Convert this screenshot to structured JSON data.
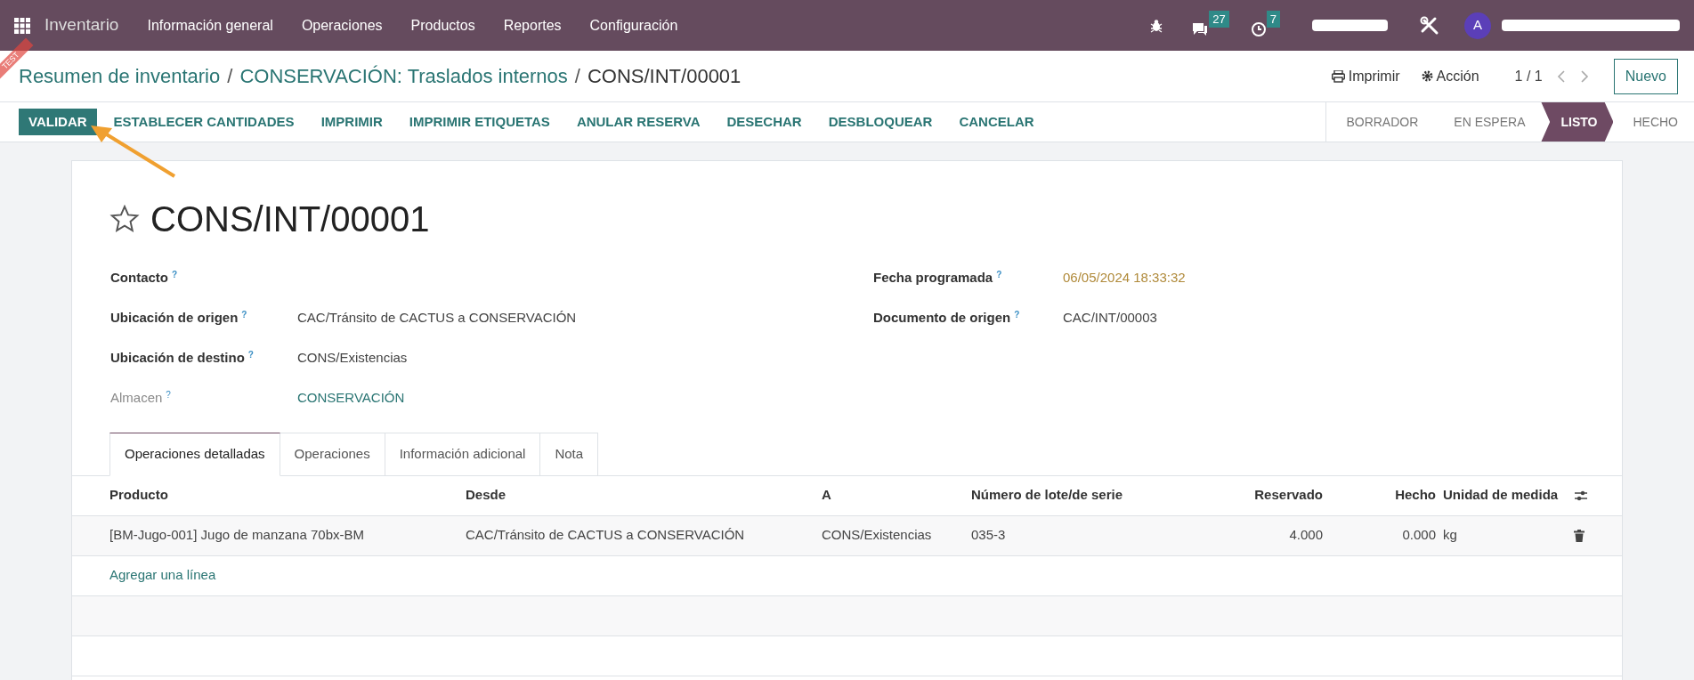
{
  "navbar": {
    "app_name": "Inventario",
    "menu": [
      "Información general",
      "Operaciones",
      "Productos",
      "Reportes",
      "Configuración"
    ],
    "messages_count": "27",
    "activities_count": "7",
    "avatar_letter": "A"
  },
  "ribbon": {
    "text": "TEST"
  },
  "breadcrumb": [
    "Resumen de inventario",
    "CONSERVACIÓN: Traslados internos",
    "CONS/INT/00001"
  ],
  "breadcrumb_separators": [
    "/",
    "/"
  ],
  "control_panel": {
    "print": "Imprimir",
    "action": "Acción",
    "pager": "1 / 1",
    "new_button": "Nuevo"
  },
  "action_buttons": [
    {
      "label": "VALIDAR",
      "primary": true
    },
    {
      "label": "ESTABLECER CANTIDADES",
      "primary": false
    },
    {
      "label": "IMPRIMIR",
      "primary": false
    },
    {
      "label": "IMPRIMIR ETIQUETAS",
      "primary": false
    },
    {
      "label": "ANULAR RESERVA",
      "primary": false
    },
    {
      "label": "DESECHAR",
      "primary": false
    },
    {
      "label": "DESBLOQUEAR",
      "primary": false
    },
    {
      "label": "CANCELAR",
      "primary": false
    }
  ],
  "status_steps": [
    {
      "label": "BORRADOR",
      "selected": false
    },
    {
      "label": "EN ESPERA",
      "selected": false
    },
    {
      "label": "LISTO",
      "selected": true
    },
    {
      "label": "HECHO",
      "selected": false
    }
  ],
  "form": {
    "title": "CONS/INT/00001",
    "starred": false,
    "left_fields": [
      {
        "label": "Contacto",
        "help": "?",
        "muted": false
      },
      {
        "label": "Ubicación de origen",
        "help": "?",
        "value": "CAC/Tránsito de CACTUS a CONSERVACIÓN",
        "kind": "plain",
        "muted": false
      },
      {
        "label": "Ubicación de destino",
        "help": "?",
        "value": "CONS/Existencias",
        "kind": "plain",
        "muted": false
      },
      {
        "label": "Almacen",
        "help": "?",
        "value": "CONSERVACIÓN",
        "kind": "link",
        "muted": true
      }
    ],
    "right_fields": [
      {
        "label": "Fecha programada",
        "help": "?",
        "value": "06/05/2024 18:33:32",
        "kind": "date",
        "muted": false
      },
      {
        "label": "Documento de origen",
        "help": "?",
        "value": "CAC/INT/00003",
        "kind": "plain",
        "muted": false
      }
    ]
  },
  "tabs": [
    {
      "label": "Operaciones detalladas",
      "selected": true
    },
    {
      "label": "Operaciones",
      "selected": false
    },
    {
      "label": "Información adicional",
      "selected": false
    },
    {
      "label": "Nota",
      "selected": false
    }
  ],
  "table": {
    "columns": [
      "Producto",
      "Desde",
      "A",
      "Número de lote/de serie",
      "Reservado",
      "Hecho",
      "Unidad de medida"
    ],
    "rows": [
      [
        "[BM-Jugo-001] Jugo de manzana 70bx-BM",
        "CAC/Tránsito de CACTUS a CONSERVACIÓN",
        "CONS/Existencias",
        "035-3",
        "4.000",
        "0.000",
        "kg"
      ]
    ],
    "add_line": "Agregar una línea"
  }
}
